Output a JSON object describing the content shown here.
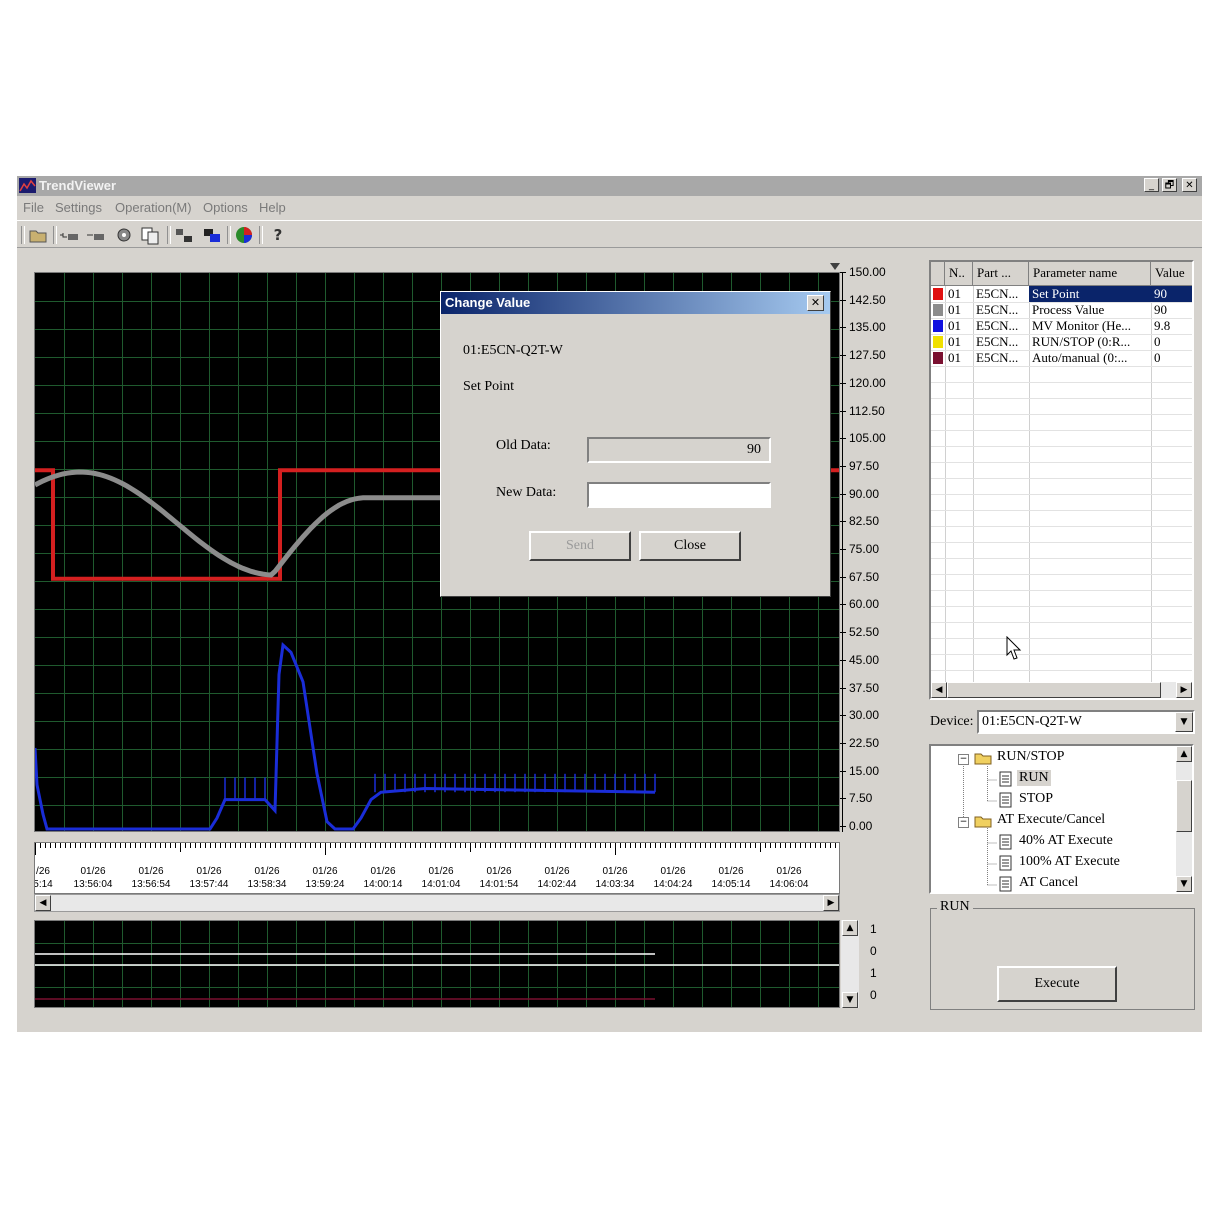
{
  "window": {
    "title": "TrendViewer",
    "controls": {
      "minimize": "_",
      "restore": "🗗",
      "close": "✕"
    }
  },
  "menu": [
    "File",
    "Settings",
    "Operation(M)",
    "Options",
    "Help"
  ],
  "toolbar": {
    "icons": [
      "open-folder-icon",
      "add-icon",
      "remove-icon",
      "settings-icon",
      "copy-icon",
      "connect-icon",
      "overlay-icon",
      "color-icon",
      "help-icon"
    ]
  },
  "trend": {
    "y_ticks": [
      "150.00",
      "142.50",
      "135.00",
      "127.50",
      "120.00",
      "112.50",
      "105.00",
      "97.50",
      "90.00",
      "82.50",
      "75.00",
      "67.50",
      "60.00",
      "52.50",
      "45.00",
      "37.50",
      "30.00",
      "22.50",
      "15.00",
      "7.50",
      "0.00"
    ],
    "time_labels": [
      {
        "date": "/26",
        "time": "5:14"
      },
      {
        "date": "01/26",
        "time": "13:56:04"
      },
      {
        "date": "01/26",
        "time": "13:56:54"
      },
      {
        "date": "01/26",
        "time": "13:57:44"
      },
      {
        "date": "01/26",
        "time": "13:58:34"
      },
      {
        "date": "01/26",
        "time": "13:59:24"
      },
      {
        "date": "01/26",
        "time": "14:00:14"
      },
      {
        "date": "01/26",
        "time": "14:01:04"
      },
      {
        "date": "01/26",
        "time": "14:01:54"
      },
      {
        "date": "01/26",
        "time": "14:02:44"
      },
      {
        "date": "01/26",
        "time": "14:03:34"
      },
      {
        "date": "01/26",
        "time": "14:04:24"
      },
      {
        "date": "01/26",
        "time": "14:05:14"
      },
      {
        "date": "01/26",
        "time": "14:06:04"
      }
    ],
    "sub_labels": [
      "1",
      "0",
      "1",
      "0"
    ],
    "colors": {
      "set_point": "#d42020",
      "process_value": "#8c8c8c",
      "mv_monitor": "#1a2dd8",
      "grid": "#1f5a2e"
    }
  },
  "dialog": {
    "title": "Change Value",
    "device": "01:E5CN-Q2T-W",
    "parameter": "Set Point",
    "old_data_label": "Old Data:",
    "old_data_value": "90",
    "new_data_label": "New Data:",
    "new_data_value": "",
    "send_label": "Send",
    "close_label": "Close"
  },
  "parameters": {
    "headers": [
      "N..",
      "Part ...",
      "Parameter name",
      "Value"
    ],
    "rows": [
      {
        "color": "#e01010",
        "no": "01",
        "part": "E5CN...",
        "name": "Set Point",
        "value": "90",
        "selected": true
      },
      {
        "color": "#8c8c8c",
        "no": "01",
        "part": "E5CN...",
        "name": "Process Value",
        "value": "90",
        "selected": false
      },
      {
        "color": "#1010e0",
        "no": "01",
        "part": "E5CN...",
        "name": "MV Monitor (He...",
        "value": "9.8",
        "selected": false
      },
      {
        "color": "#f0e000",
        "no": "01",
        "part": "E5CN...",
        "name": "RUN/STOP (0:R...",
        "value": "0",
        "selected": false
      },
      {
        "color": "#7a1030",
        "no": "01",
        "part": "E5CN...",
        "name": "Auto/manual (0:...",
        "value": "0",
        "selected": false
      }
    ]
  },
  "device": {
    "label": "Device:",
    "value": "01:E5CN-Q2T-W"
  },
  "tree": {
    "run_stop": "RUN/STOP",
    "run": "RUN",
    "stop": "STOP",
    "at": "AT Execute/Cancel",
    "at40": "40% AT Execute",
    "at100": "100% AT Execute",
    "atcancel": "AT Cancel"
  },
  "run_group": {
    "label": "RUN",
    "execute_label": "Execute"
  }
}
